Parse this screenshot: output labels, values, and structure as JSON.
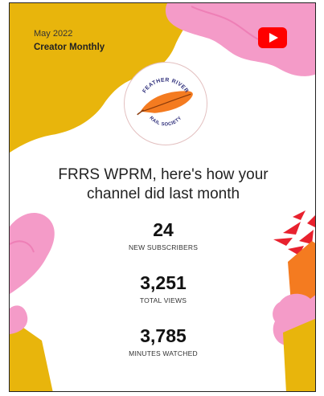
{
  "header": {
    "date": "May 2022",
    "title": "Creator Monthly"
  },
  "logo": {
    "org_top": "FEATHER RIVER",
    "org_bottom": "RAIL SOCIETY"
  },
  "headline": "FRRS WPRM, here's how your channel did last month",
  "stats": [
    {
      "value": "24",
      "label": "NEW SUBSCRIBERS"
    },
    {
      "value": "3,251",
      "label": "TOTAL VIEWS"
    },
    {
      "value": "3,785",
      "label": "MINUTES WATCHED"
    }
  ],
  "colors": {
    "mustard": "#E8B50C",
    "pink": "#F49BC8",
    "red": "#E8212E",
    "orange": "#F47B20",
    "youtube_red": "#FF0000"
  },
  "icons": {
    "youtube": "youtube-play-icon",
    "logo": "feather-river-rail-society-logo"
  }
}
